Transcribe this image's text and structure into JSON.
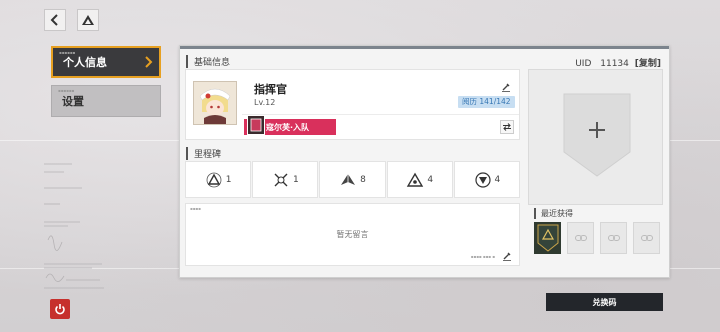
{
  "nav": {
    "items": [
      {
        "label": "个人信息",
        "active": true
      },
      {
        "label": "设置",
        "active": false
      }
    ]
  },
  "profile": {
    "section_title": "基础信息",
    "uid_label": "UID",
    "uid_value": "11134",
    "copy_label": "[复制]",
    "name": "指挥官",
    "level": "Lv.12",
    "exp": "阅历 141/142",
    "team_tag": "寇尔芙·入队"
  },
  "milestones": {
    "title": "里程碑",
    "items": [
      {
        "icon": "triangle-badge-icon",
        "count": "1"
      },
      {
        "icon": "crossed-swords-icon",
        "count": "1"
      },
      {
        "icon": "pyramid-icon",
        "count": "8"
      },
      {
        "icon": "eye-triangle-icon",
        "count": "4"
      },
      {
        "icon": "circle-triangle-icon",
        "count": "4"
      }
    ]
  },
  "message": {
    "empty_text": "暂无留言"
  },
  "recent": {
    "title": "最近获得"
  },
  "redeem_label": "兑换码",
  "colors": {
    "accent": "#e7a021",
    "team_tag": "#d9305c",
    "power": "#c6302c",
    "exp_bg": "#c7def2"
  }
}
